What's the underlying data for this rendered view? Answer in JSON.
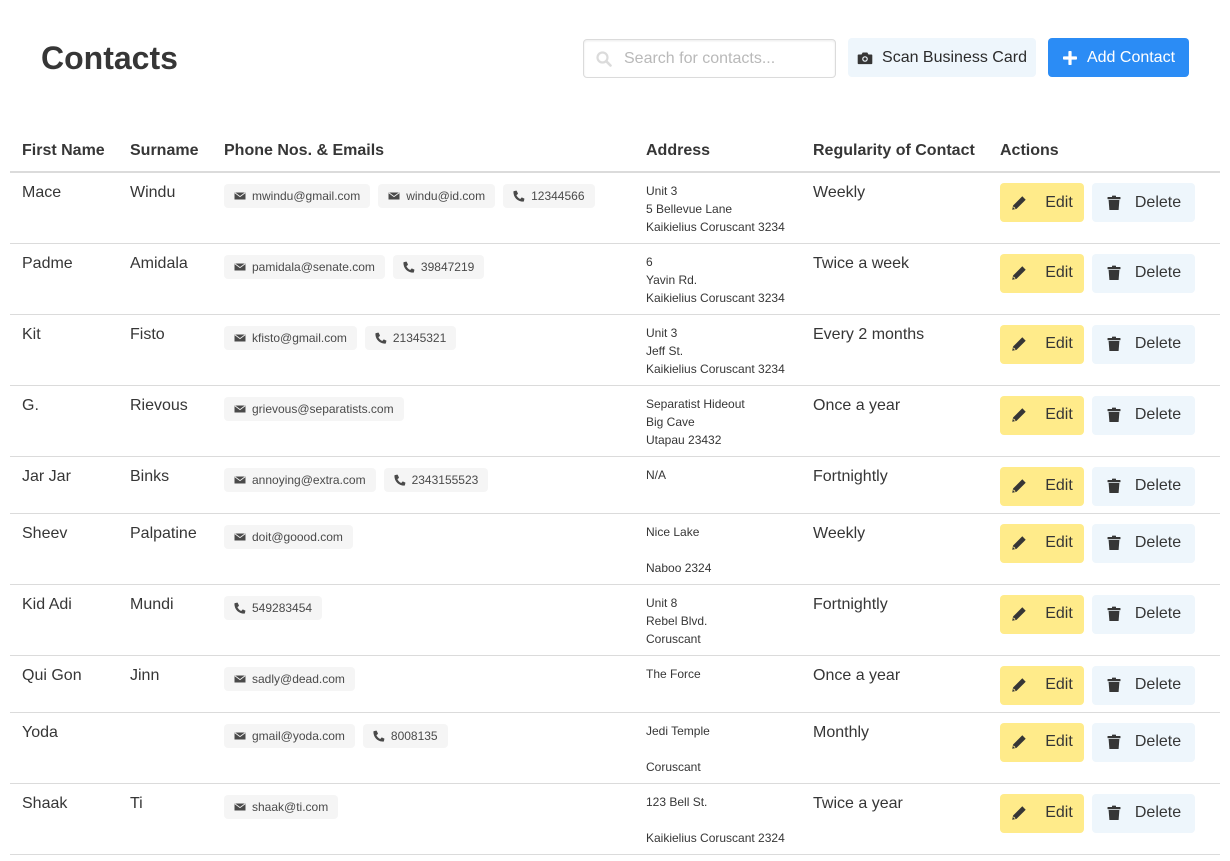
{
  "header": {
    "title": "Contacts",
    "search_placeholder": "Search for contacts...",
    "scan_label": "Scan Business Card",
    "add_label": "Add Contact"
  },
  "columns": [
    "First Name",
    "Surname",
    "Phone Nos. & Emails",
    "Address",
    "Regularity of Contact",
    "Actions"
  ],
  "actions": {
    "edit_label": "Edit",
    "delete_label": "Delete"
  },
  "colors": {
    "primary": "#2b8cf5",
    "warning": "#ffeb8a",
    "light_info": "#eef6fc",
    "tag_bg": "#f5f5f5"
  },
  "contacts": [
    {
      "first": "Mace",
      "surname": "Windu",
      "details": [
        {
          "type": "email",
          "value": "mwindu@gmail.com"
        },
        {
          "type": "email",
          "value": "windu@id.com"
        },
        {
          "type": "phone",
          "value": "12344566"
        }
      ],
      "address": [
        "Unit 3",
        "5 Bellevue Lane",
        "Kaikielius Coruscant 3234"
      ],
      "regularity": "Weekly"
    },
    {
      "first": "Padme",
      "surname": "Amidala",
      "details": [
        {
          "type": "email",
          "value": "pamidala@senate.com"
        },
        {
          "type": "phone",
          "value": "39847219"
        }
      ],
      "address": [
        "6",
        "Yavin Rd.",
        "Kaikielius Coruscant 3234"
      ],
      "regularity": "Twice a week"
    },
    {
      "first": "Kit",
      "surname": "Fisto",
      "details": [
        {
          "type": "email",
          "value": "kfisto@gmail.com"
        },
        {
          "type": "phone",
          "value": "21345321"
        }
      ],
      "address": [
        "Unit 3",
        "Jeff St.",
        "Kaikielius Coruscant 3234"
      ],
      "regularity": "Every 2 months"
    },
    {
      "first": "G.",
      "surname": "Rievous",
      "details": [
        {
          "type": "email",
          "value": "grievous@separatists.com"
        }
      ],
      "address": [
        "Separatist Hideout",
        "Big Cave",
        "Utapau 23432"
      ],
      "regularity": "Once a year"
    },
    {
      "first": "Jar Jar",
      "surname": "Binks",
      "details": [
        {
          "type": "email",
          "value": "annoying@extra.com"
        },
        {
          "type": "phone",
          "value": "2343155523"
        }
      ],
      "address": [
        "N/A"
      ],
      "regularity": "Fortnightly"
    },
    {
      "first": "Sheev",
      "surname": "Palpatine",
      "details": [
        {
          "type": "email",
          "value": "doit@goood.com"
        }
      ],
      "address": [
        "Nice Lake",
        "",
        "Naboo 2324"
      ],
      "regularity": "Weekly"
    },
    {
      "first": "Kid Adi",
      "surname": "Mundi",
      "details": [
        {
          "type": "phone",
          "value": "549283454"
        }
      ],
      "address": [
        "Unit 8",
        "Rebel Blvd.",
        "Coruscant"
      ],
      "regularity": "Fortnightly"
    },
    {
      "first": "Qui Gon",
      "surname": "Jinn",
      "details": [
        {
          "type": "email",
          "value": "sadly@dead.com"
        }
      ],
      "address": [
        "The Force"
      ],
      "regularity": "Once a year"
    },
    {
      "first": "Yoda",
      "surname": "",
      "details": [
        {
          "type": "email",
          "value": "gmail@yoda.com"
        },
        {
          "type": "phone",
          "value": "8008135"
        }
      ],
      "address": [
        "Jedi Temple",
        "",
        "Coruscant"
      ],
      "regularity": "Monthly"
    },
    {
      "first": "Shaak",
      "surname": "Ti",
      "details": [
        {
          "type": "email",
          "value": "shaak@ti.com"
        }
      ],
      "address": [
        "123 Bell St.",
        "",
        "Kaikielius Coruscant 2324"
      ],
      "regularity": "Twice a year"
    }
  ]
}
